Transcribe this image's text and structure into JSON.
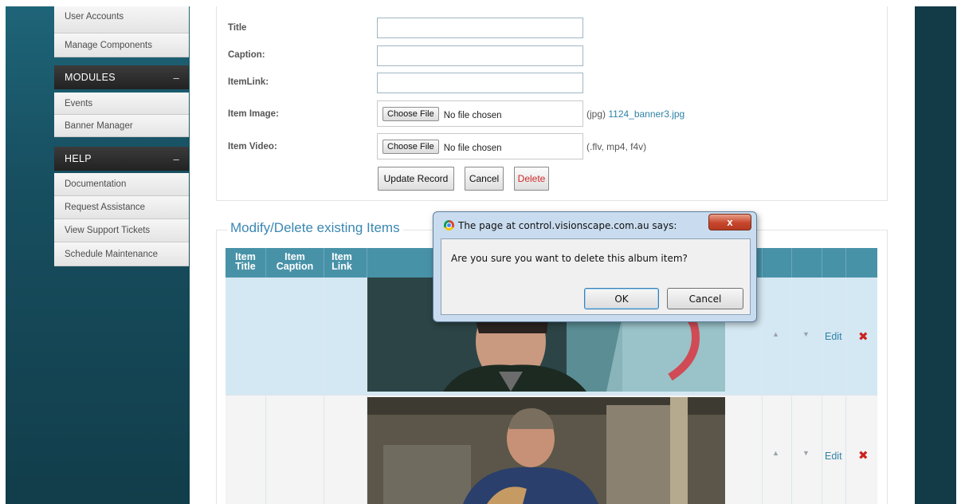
{
  "sidebar": {
    "links_top": [
      "User Accounts",
      "Manage Components"
    ],
    "modules": {
      "heading": "MODULES",
      "collapse": "–",
      "items": [
        "Events",
        "Banner Manager"
      ]
    },
    "help": {
      "heading": "HELP",
      "collapse": "–",
      "items": [
        "Documentation",
        "Request Assistance",
        "View Support Tickets",
        "Schedule Maintenance"
      ]
    }
  },
  "form": {
    "title_label": "Title",
    "caption_label": "Caption:",
    "itemlink_label": "ItemLink:",
    "item_image_label": "Item Image:",
    "item_video_label": "Item Video:",
    "choose_file": "Choose File",
    "no_file": "No file chosen",
    "image_note_prefix": "(jpg)",
    "image_current_file": "1124_banner3.jpg",
    "video_note": "(.flv, mp4, f4v)",
    "update_button": "Update Record",
    "cancel_button": "Cancel",
    "delete_button": "Delete"
  },
  "items": {
    "legend": "Modify/Delete existing Items",
    "columns": [
      {
        "line1": "Item",
        "line2": "Title"
      },
      {
        "line1": "Item",
        "line2": "Caption"
      },
      {
        "line1": "Item",
        "line2": "Link"
      }
    ],
    "rows": [
      {
        "up": "▲",
        "down": "▼",
        "edit": "Edit",
        "delete": "✖"
      },
      {
        "up": "▲",
        "down": "▼",
        "edit": "Edit",
        "delete": "✖"
      }
    ]
  },
  "dialog": {
    "title": "The page at control.visionscape.com.au says:",
    "close": "x",
    "message": "Are you sure you want to delete this album item?",
    "ok": "OK",
    "cancel": "Cancel"
  },
  "colors": {
    "accent": "#3a87b3",
    "table_header": "#4892a8",
    "sidebar_bg": "#174f60",
    "delete_red": "#cc2222"
  }
}
